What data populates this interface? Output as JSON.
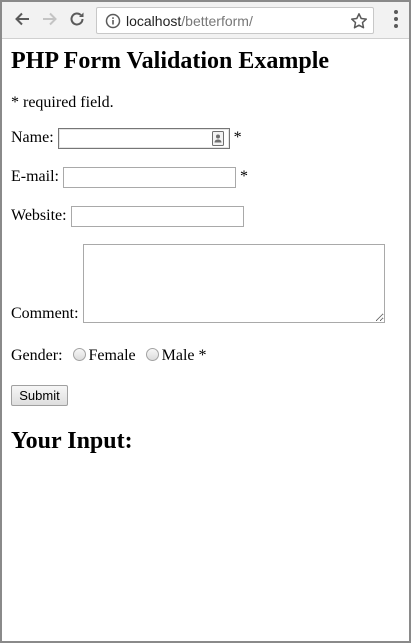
{
  "browser": {
    "url_host": "localhost",
    "url_path": "/betterform/"
  },
  "page": {
    "title": "PHP Form Validation Example",
    "required_note": "* required field.",
    "name_label": "Name:",
    "name_value": "",
    "email_label": "E-mail:",
    "email_value": "",
    "website_label": "Website:",
    "website_value": "",
    "comment_label": "Comment:",
    "comment_value": "",
    "gender_label": "Gender:",
    "gender_options": [
      "Female",
      "Male"
    ],
    "required_marker": "*",
    "submit_label": "Submit",
    "results_title": "Your Input:"
  }
}
